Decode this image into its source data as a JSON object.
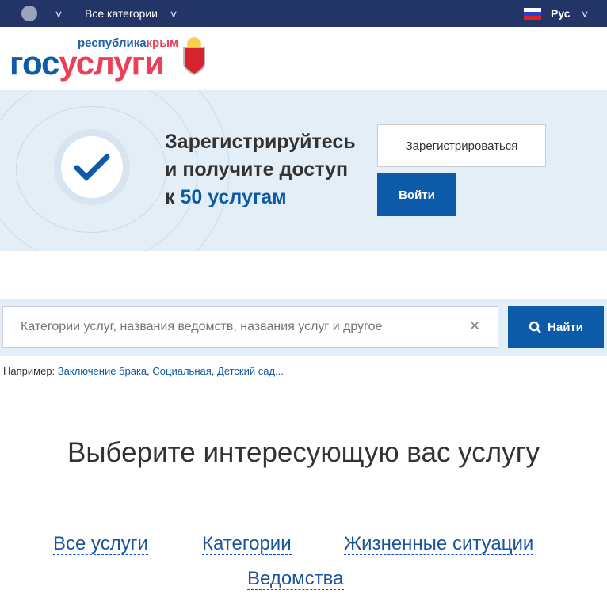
{
  "topbar": {
    "categories": "Все категории",
    "language": "Рус"
  },
  "logo": {
    "region_blue": "республика",
    "region_red": "крым",
    "gos": "гос",
    "uslugi": "услуги"
  },
  "hero": {
    "line1": "Зарегистрируйтесь",
    "line2": "и получите доступ",
    "line3_prefix": "к ",
    "line3_highlight": "50 услугам",
    "register": "Зарегистрироваться",
    "login": "Войти"
  },
  "search": {
    "placeholder": "Категории услуг, названия ведомств, названия услуг и другое",
    "clear": "×",
    "button": "Найти"
  },
  "examples": {
    "label": "Например:",
    "items": [
      "Заключение брака",
      "Социальная",
      "Детский сад..."
    ]
  },
  "main": {
    "title": "Выберите интересующую вас услугу",
    "links": [
      "Все услуги",
      "Категории",
      "Жизненные ситуации",
      "Ведомства"
    ]
  }
}
